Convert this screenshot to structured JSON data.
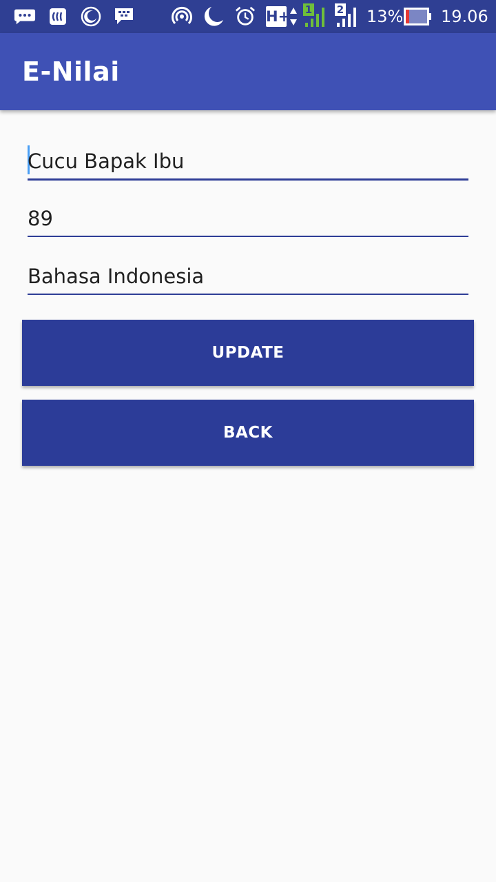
{
  "status_bar": {
    "battery_percent": "13%",
    "time": "19.06",
    "network_type": "H+",
    "sim1_label": "1",
    "sim2_label": "2",
    "icons": [
      "chat-bubble-icon",
      "nfc-icon",
      "moon-icon",
      "bbm-icon",
      "hotspot-icon",
      "do-not-disturb-icon",
      "alarm-icon",
      "network-hplus-icon",
      "signal-sim1-icon",
      "signal-sim2-icon",
      "battery-icon"
    ]
  },
  "app_bar": {
    "title": "E-Nilai"
  },
  "form": {
    "name_value": "Cucu Bapak Ibu",
    "score_value": "89",
    "subject_value": "Bahasa Indonesia"
  },
  "buttons": {
    "update_label": "UPDATE",
    "back_label": "BACK"
  },
  "colors": {
    "status_bar": "#2f3f93",
    "app_bar": "#3f51b5",
    "button": "#2c3c98",
    "underline": "#2e3d96",
    "background": "#fafafa"
  }
}
